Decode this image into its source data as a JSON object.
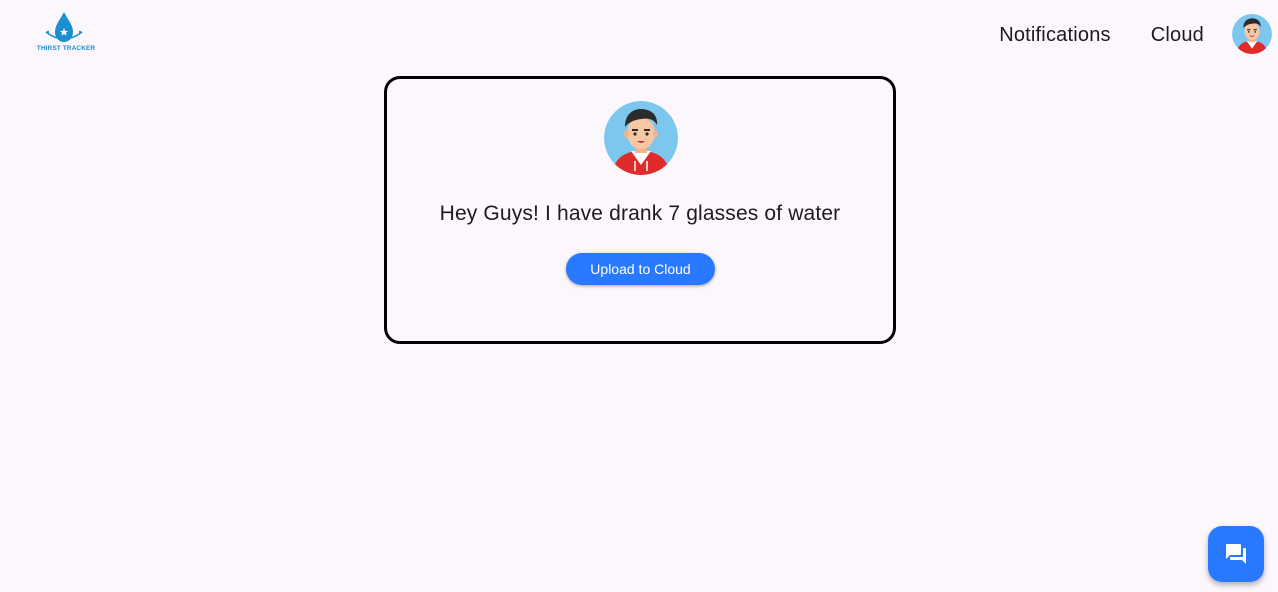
{
  "header": {
    "logo_text": "THIRST TRACKER",
    "nav": [
      {
        "label": "Notifications"
      },
      {
        "label": "Cloud"
      }
    ]
  },
  "card": {
    "message": "Hey Guys! I have drank 7 glasses of water",
    "upload_label": "Upload to Cloud"
  },
  "icons": {
    "logo": "water-drop-icon",
    "profile": "avatar",
    "fab": "chat-icon"
  },
  "colors": {
    "background": "#fcf6fd",
    "primary": "#2979ff",
    "logo": "#1b8fcf"
  }
}
